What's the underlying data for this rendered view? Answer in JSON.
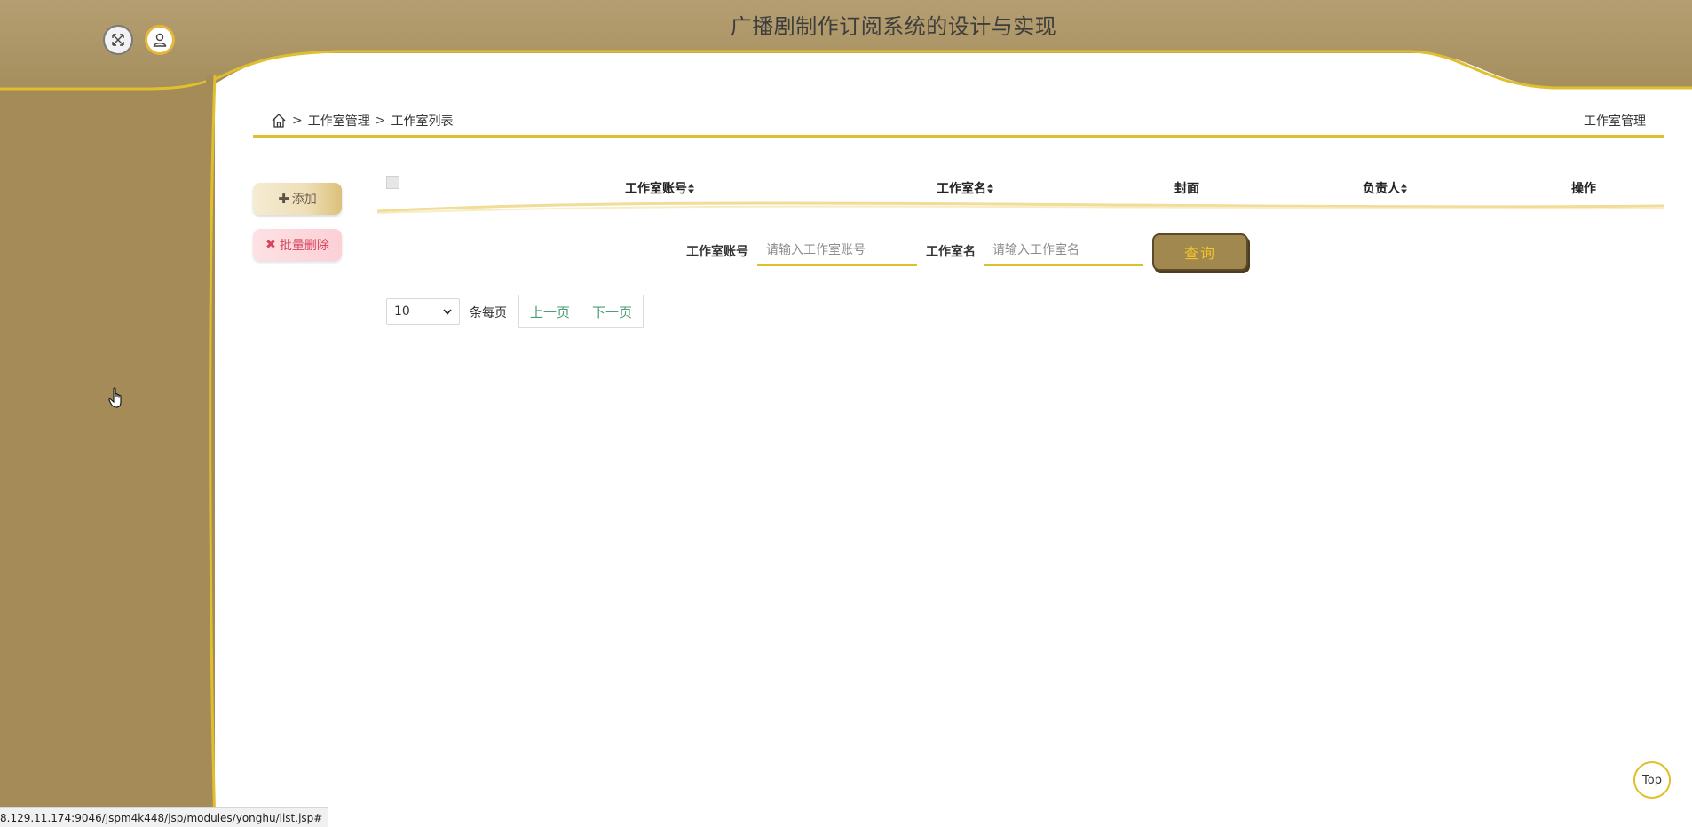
{
  "app": {
    "title": "广播剧制作订阅系统的设计与实现"
  },
  "header_icons": [
    {
      "icon": "fullscreen-icon"
    },
    {
      "icon": "user-icon"
    }
  ],
  "breadcrumb": {
    "home_icon": "home-icon",
    "separator": ">",
    "items": [
      "工作室管理",
      "工作室列表"
    ],
    "right_title": "工作室管理"
  },
  "actions": {
    "add_label": "添加",
    "batch_delete_label": "批量删除"
  },
  "table": {
    "columns": [
      {
        "label": "工作室账号",
        "sortable": true
      },
      {
        "label": "工作室名",
        "sortable": true
      },
      {
        "label": "封面",
        "sortable": false
      },
      {
        "label": "负责人",
        "sortable": true
      },
      {
        "label": "操作",
        "sortable": false
      }
    ],
    "rows": []
  },
  "search": {
    "fields": [
      {
        "label": "工作室账号",
        "placeholder": "请输入工作室账号",
        "value": ""
      },
      {
        "label": "工作室名",
        "placeholder": "请输入工作室名",
        "value": ""
      }
    ],
    "button_label": "查询"
  },
  "pagination": {
    "page_size": "10",
    "per_page_label": "条每页",
    "prev_label": "上一页",
    "next_label": "下一页"
  },
  "back_to_top_label": "Top",
  "status_bar_url": "8.129.11.174:9046/jspm4k448/jsp/modules/yonghu/list.jsp#",
  "colors": {
    "header_bg": "#b09a6b",
    "sidebar_bg": "#a48b58",
    "accent_gold": "#e0bf2e",
    "pager_text": "#4a9e78",
    "danger": "#d8435a"
  }
}
